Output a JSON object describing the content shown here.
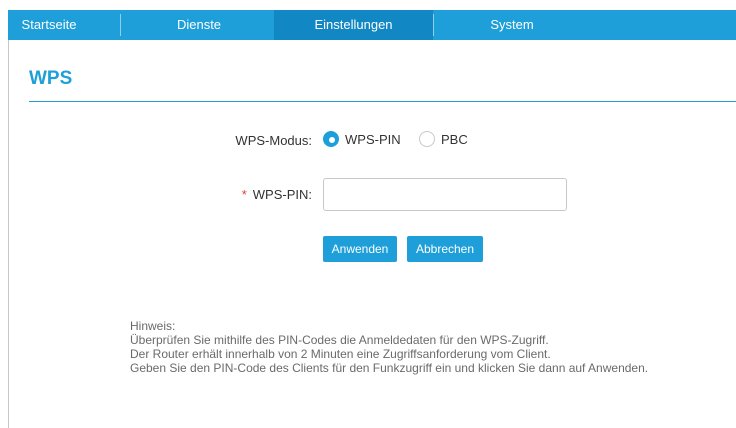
{
  "nav": {
    "tabs": [
      {
        "label": "Startseite"
      },
      {
        "label": "Dienste"
      },
      {
        "label": "Einstellungen",
        "active": true
      },
      {
        "label": "System"
      }
    ]
  },
  "page": {
    "title": "WPS"
  },
  "form": {
    "mode_label": "WPS-Modus:",
    "mode_options": [
      {
        "label": "WPS-PIN",
        "selected": true
      },
      {
        "label": "PBC",
        "selected": false
      }
    ],
    "required_marker": "*",
    "pin_label": "WPS-PIN:",
    "pin_value": "",
    "apply_label": "Anwenden",
    "cancel_label": "Abbrechen"
  },
  "hint": {
    "title": "Hinweis:",
    "lines": [
      "Überprüfen Sie mithilfe des PIN-Codes die Anmeldedaten für den WPS-Zugriff.",
      "Der Router erhält innerhalb von 2 Minuten eine Zugriffsanforderung vom Client.",
      "Geben Sie den PIN-Code des Clients für den Funkzugriff ein und klicken Sie dann auf Anwenden."
    ]
  },
  "colors": {
    "accent": "#1e9fda",
    "tab_active": "#1188c4",
    "required": "#e63b3b"
  }
}
